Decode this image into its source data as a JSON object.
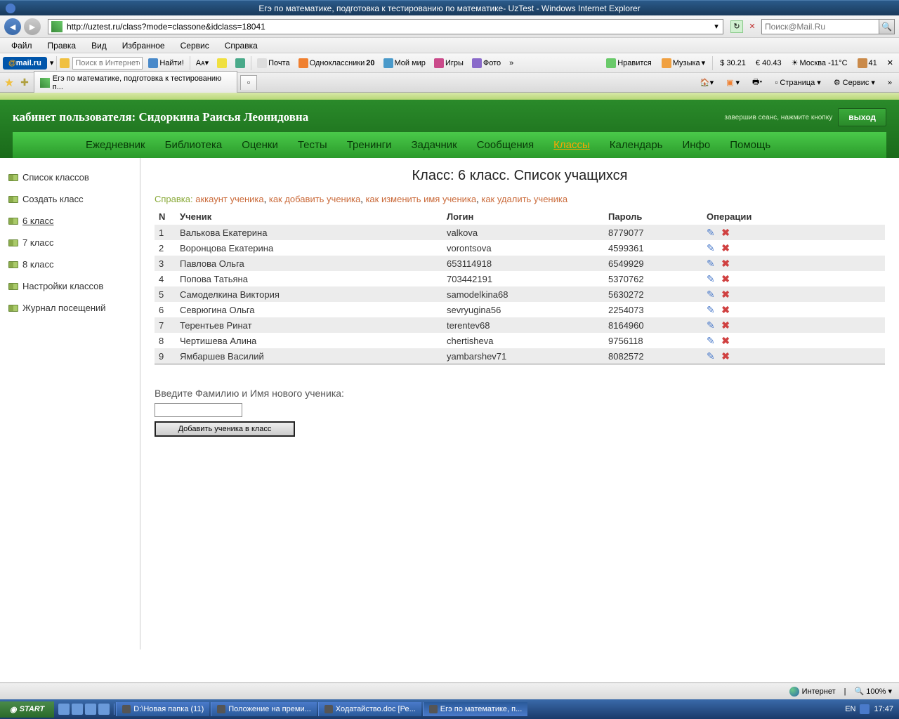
{
  "window": {
    "title": "Егэ по математике, подготовка к тестированию по математике- UzTest - Windows Internet Explorer"
  },
  "address": {
    "url": "http://uztest.ru/class?mode=classone&idclass=18041",
    "search_placeholder": "Поиск@Mail.Ru"
  },
  "menu": [
    "Файл",
    "Правка",
    "Вид",
    "Избранное",
    "Сервис",
    "Справка"
  ],
  "mailru": {
    "logo_a": "@",
    "logo_b": "mail.ru",
    "search_placeholder": "Поиск в Интернете",
    "find": "Найти!",
    "items": [
      "Почта",
      "Одноклассники",
      "Мой мир",
      "Игры",
      "Фото"
    ],
    "odno_count": "20",
    "right": {
      "like": "Нравится",
      "music": "Музыка",
      "usd": "$ 30.21",
      "eur": "€ 40.43",
      "weather": "Москва -11°C",
      "extra": "41"
    }
  },
  "tab": {
    "title": "Егэ по математике, подготовка к тестированию п..."
  },
  "favright": {
    "page": "Страница",
    "service": "Сервис"
  },
  "header": {
    "cabinet": "кабинет пользователя: Сидоркина Раисья Леонидовна",
    "logout_hint": "завершив сеанс, нажмите кнопку",
    "logout": "выход",
    "nav": [
      "Ежедневник",
      "Библиотека",
      "Оценки",
      "Тесты",
      "Тренинги",
      "Задачник",
      "Сообщения",
      "Классы",
      "Календарь",
      "Инфо",
      "Помощь"
    ],
    "active_nav": "Классы"
  },
  "sidebar": [
    "Список классов",
    "Создать класс",
    "6 класс",
    "7 класс",
    "8 класс",
    "Настройки классов",
    "Журнал посещений"
  ],
  "sidebar_active": "6 класс",
  "main": {
    "heading": "Класс: 6 класс. Список учащихся",
    "help_label": "Справка:",
    "help_links": [
      "аккаунт ученика",
      "как добавить ученика",
      "как изменить имя ученика",
      "как удалить ученика"
    ],
    "columns": {
      "n": "N",
      "student": "Ученик",
      "login": "Логин",
      "password": "Пароль",
      "ops": "Операции"
    },
    "rows": [
      {
        "n": "1",
        "name": "Валькова Екатерина",
        "login": "valkova",
        "password": "8779077"
      },
      {
        "n": "2",
        "name": "Воронцова Екатерина",
        "login": "vorontsova",
        "password": "4599361"
      },
      {
        "n": "3",
        "name": "Павлова Ольга",
        "login": "653114918",
        "password": "6549929"
      },
      {
        "n": "4",
        "name": "Попова Татьяна",
        "login": "703442191",
        "password": "5370762"
      },
      {
        "n": "5",
        "name": "Самоделкина Виктория",
        "login": "samodelkina68",
        "password": "5630272"
      },
      {
        "n": "6",
        "name": "Севрюгина Ольга",
        "login": "sevryugina56",
        "password": "2254073"
      },
      {
        "n": "7",
        "name": "Терентьев Ринат",
        "login": "terentev68",
        "password": "8164960"
      },
      {
        "n": "8",
        "name": "Чертишева Алина",
        "login": "chertisheva",
        "password": "9756118"
      },
      {
        "n": "9",
        "name": "Ямбаршев Василий",
        "login": "yambarshev71",
        "password": "8082572"
      }
    ],
    "add_label": "Введите Фамилию и Имя нового ученика:",
    "add_button": "Добавить ученика в класс"
  },
  "status": {
    "internet": "Интернет",
    "zoom": "100%"
  },
  "taskbar": {
    "start": "START",
    "items": [
      "D:\\Новая папка (11)",
      "Положение на преми...",
      "Ходатайство.doc [Ре...",
      "Егэ по математике, п..."
    ],
    "lang": "EN",
    "time": "17:47"
  }
}
